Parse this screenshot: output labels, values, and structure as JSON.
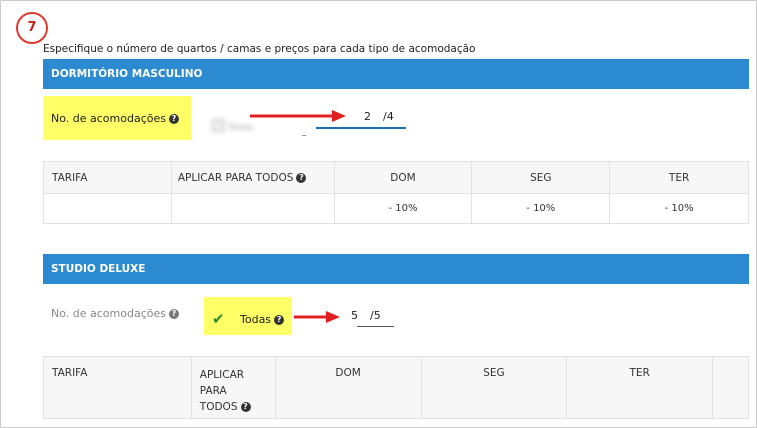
{
  "step_number": "7",
  "intro_text": "Especifique o número de quartos / camas e preços para cada tipo de acomodação",
  "rooms": [
    {
      "title": "DORMITÓRIO MASCULINO",
      "accommodations_label": "No. de acomodações",
      "all_label": "Todas",
      "count": "2",
      "total": "/4",
      "columns": [
        "TARIFA",
        "APLICAR PARA TODOS",
        "DOM",
        "SEG",
        "TER"
      ],
      "discounts": [
        "- 10%",
        "- 10%",
        "- 10%"
      ]
    },
    {
      "title": "STUDIO DELUXE",
      "accommodations_label": "No. de acomodações",
      "all_label": "Todas",
      "count": "5",
      "total": "/5",
      "columns": [
        "TARIFA",
        "APLICAR PARA TODOS",
        "DOM",
        "SEG",
        "TER"
      ],
      "apply_lines": [
        "APLICAR",
        "PARA",
        "TODOS"
      ]
    }
  ],
  "colors": {
    "header_blue": "#2b8ad0",
    "highlight_yellow": "#ffff66",
    "arrow_red": "#e02020",
    "check_green": "#2e8b2e"
  },
  "icons": {
    "help": "question-circle-icon",
    "check": "checkmark-icon",
    "arrow": "red-arrow-icon",
    "step": "step-number-badge"
  }
}
